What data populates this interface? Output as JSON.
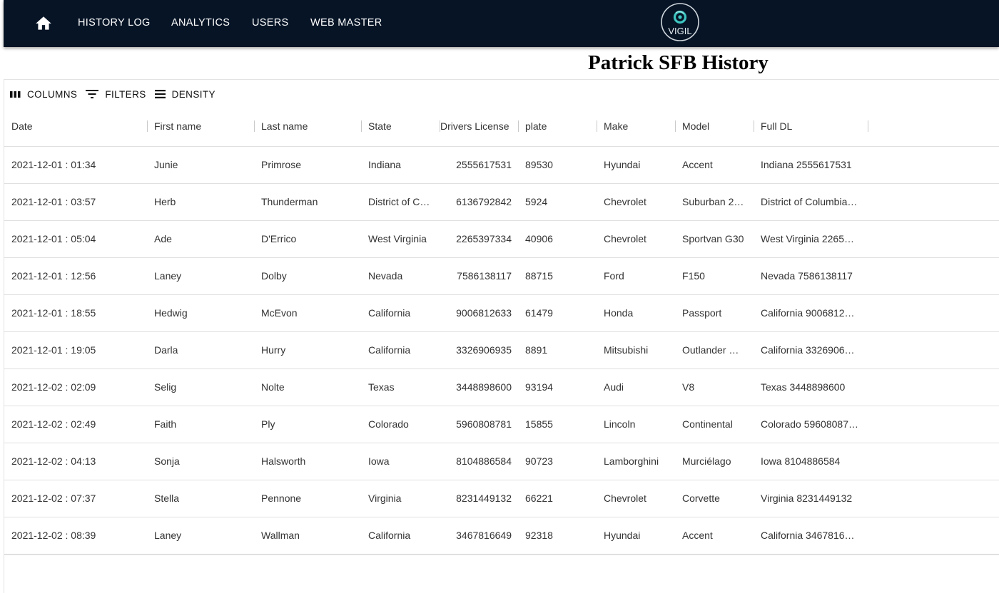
{
  "nav": {
    "items": [
      "HISTORY LOG",
      "ANALYTICS",
      "USERS",
      "WEB MASTER"
    ],
    "logo_text": "VIGIL",
    "bar_color": "#061426",
    "logo_accent": "#3ec6c1"
  },
  "page": {
    "title": "Patrick SFB History"
  },
  "toolbar": {
    "columns_label": "COLUMNS",
    "filters_label": "FILTERS",
    "density_label": "DENSITY"
  },
  "table": {
    "headers": [
      "Date",
      "First name",
      "Last name",
      "State",
      "Drivers License",
      "plate",
      "Make",
      "Model",
      "Full DL"
    ],
    "rows": [
      [
        "2021-12-01 : 01:34",
        "Junie",
        "Primrose",
        "Indiana",
        "2555617531",
        "89530",
        "Hyundai",
        "Accent",
        "Indiana 2555617531"
      ],
      [
        "2021-12-01 : 03:57",
        "Herb",
        "Thunderman",
        "District of C…",
        "6136792842",
        "5924",
        "Chevrolet",
        "Suburban 2…",
        "District of Columbia…"
      ],
      [
        "2021-12-01 : 05:04",
        "Ade",
        "D'Errico",
        "West Virginia",
        "2265397334",
        "40906",
        "Chevrolet",
        "Sportvan G30",
        "West Virginia 2265…"
      ],
      [
        "2021-12-01 : 12:56",
        "Laney",
        "Dolby",
        "Nevada",
        "7586138117",
        "88715",
        "Ford",
        "F150",
        "Nevada 7586138117"
      ],
      [
        "2021-12-01 : 18:55",
        "Hedwig",
        "McEvon",
        "California",
        "9006812633",
        "61479",
        "Honda",
        "Passport",
        "California 9006812…"
      ],
      [
        "2021-12-01 : 19:05",
        "Darla",
        "Hurry",
        "California",
        "3326906935",
        "8891",
        "Mitsubishi",
        "Outlander …",
        "California 3326906…"
      ],
      [
        "2021-12-02 : 02:09",
        "Selig",
        "Nolte",
        "Texas",
        "3448898600",
        "93194",
        "Audi",
        "V8",
        "Texas 3448898600"
      ],
      [
        "2021-12-02 : 02:49",
        "Faith",
        "Ply",
        "Colorado",
        "5960808781",
        "15855",
        "Lincoln",
        "Continental",
        "Colorado 59608087…"
      ],
      [
        "2021-12-02 : 04:13",
        "Sonja",
        "Halsworth",
        "Iowa",
        "8104886584",
        "90723",
        "Lamborghini",
        "Murciélago",
        "Iowa 8104886584"
      ],
      [
        "2021-12-02 : 07:37",
        "Stella",
        "Pennone",
        "Virginia",
        "8231449132",
        "66221",
        "Chevrolet",
        "Corvette",
        "Virginia 8231449132"
      ],
      [
        "2021-12-02 : 08:39",
        "Laney",
        "Wallman",
        "California",
        "3467816649",
        "92318",
        "Hyundai",
        "Accent",
        "California 3467816…"
      ]
    ]
  }
}
